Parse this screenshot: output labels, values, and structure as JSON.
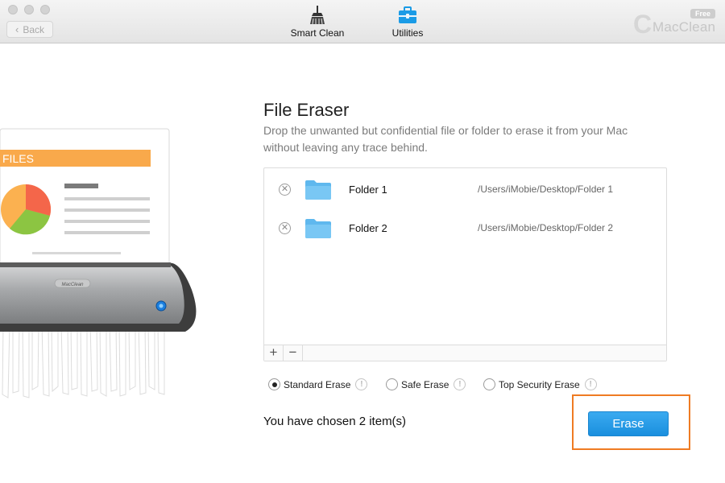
{
  "toolbar": {
    "back_label": "Back",
    "smart_clean_label": "Smart Clean",
    "utilities_label": "Utilities",
    "brand_name": "MacClean",
    "brand_badge": "Free",
    "active_color": "#1a9be6"
  },
  "illustration": {
    "doc_banner": "FILES",
    "shredder_label": "MacClean"
  },
  "eraser": {
    "title": "File Eraser",
    "description": "Drop the unwanted but confidential file or folder to erase it from your Mac without leaving any trace behind.",
    "files": [
      {
        "name": "Folder 1",
        "path": "/Users/iMobie/Desktop/Folder 1"
      },
      {
        "name": "Folder 2",
        "path": "/Users/iMobie/Desktop/Folder 2"
      }
    ],
    "add_label": "+",
    "remove_label": "−",
    "options": [
      {
        "label": "Standard Erase",
        "selected": true
      },
      {
        "label": "Safe Erase",
        "selected": false
      },
      {
        "label": "Top Security Erase",
        "selected": false
      }
    ],
    "chosen_text": "You have chosen 2 item(s)",
    "erase_label": "Erase",
    "highlight_color": "#ef7b23"
  }
}
